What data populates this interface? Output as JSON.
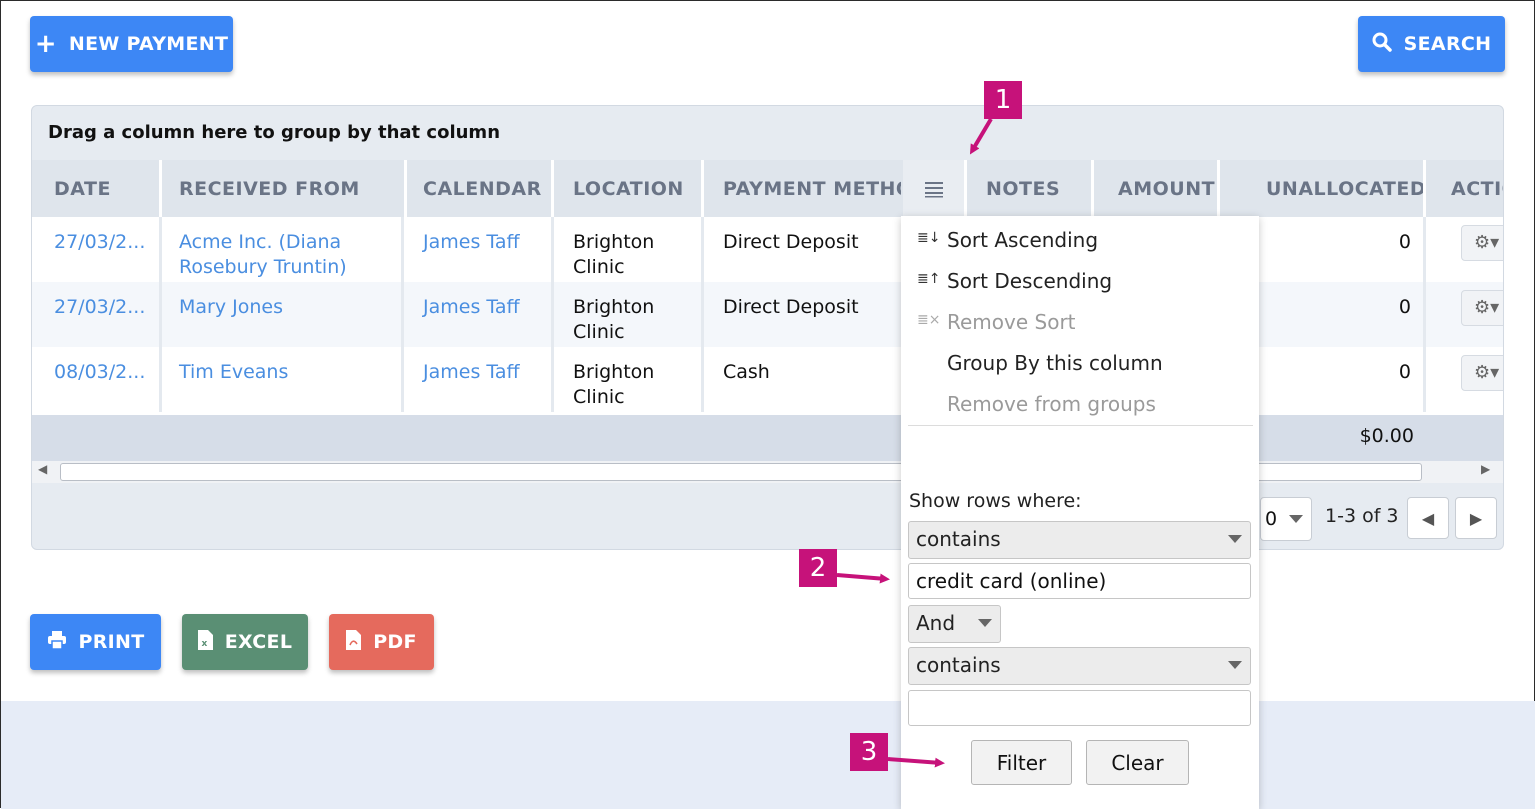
{
  "toolbar": {
    "new_payment_label": "NEW PAYMENT",
    "search_label": "SEARCH"
  },
  "grid": {
    "group_bar_text": "Drag a column here to group by that column",
    "columns": [
      "DATE",
      "RECEIVED FROM",
      "CALENDAR",
      "LOCATION",
      "PAYMENT METHO",
      "NOTES",
      "AMOUNT",
      "UNALLOCATED",
      "ACTIO"
    ],
    "rows": [
      {
        "date": "27/03/2...",
        "received_from": "Acme Inc. (Diana Rosebury Truntin)",
        "calendar": "James Taff",
        "location": "Brighton Clinic",
        "payment_method": "Direct Deposit",
        "unallocated": "0"
      },
      {
        "date": "27/03/2...",
        "received_from": "Mary Jones",
        "calendar": "James Taff",
        "location": "Brighton Clinic",
        "payment_method": "Direct Deposit",
        "unallocated": "0"
      },
      {
        "date": "08/03/2...",
        "received_from": "Tim Eveans",
        "calendar": "James Taff",
        "location": "Brighton Clinic",
        "payment_method": "Cash",
        "unallocated": "0"
      }
    ],
    "footer_total": "$0.00",
    "pager": {
      "page_size": "0",
      "info": "1-3 of 3"
    }
  },
  "column_menu": {
    "sort_ascending": "Sort Ascending",
    "sort_descending": "Sort Descending",
    "remove_sort": "Remove Sort",
    "group_by": "Group By this column",
    "remove_groups": "Remove from groups",
    "show_rows_where": "Show rows where:",
    "operator_1": "contains",
    "value_1": "credit card (online)",
    "logic": "And",
    "operator_2": "contains",
    "value_2": "",
    "filter_label": "Filter",
    "clear_label": "Clear"
  },
  "export": {
    "print_label": "PRINT",
    "excel_label": "EXCEL",
    "pdf_label": "PDF"
  },
  "callouts": [
    "1",
    "2",
    "3"
  ],
  "colors": {
    "primary_blue": "#3d87f5",
    "excel_green": "#5a8f74",
    "pdf_red": "#e56a5d",
    "callout_magenta": "#c6127a",
    "link_blue": "#4a8ee0"
  }
}
